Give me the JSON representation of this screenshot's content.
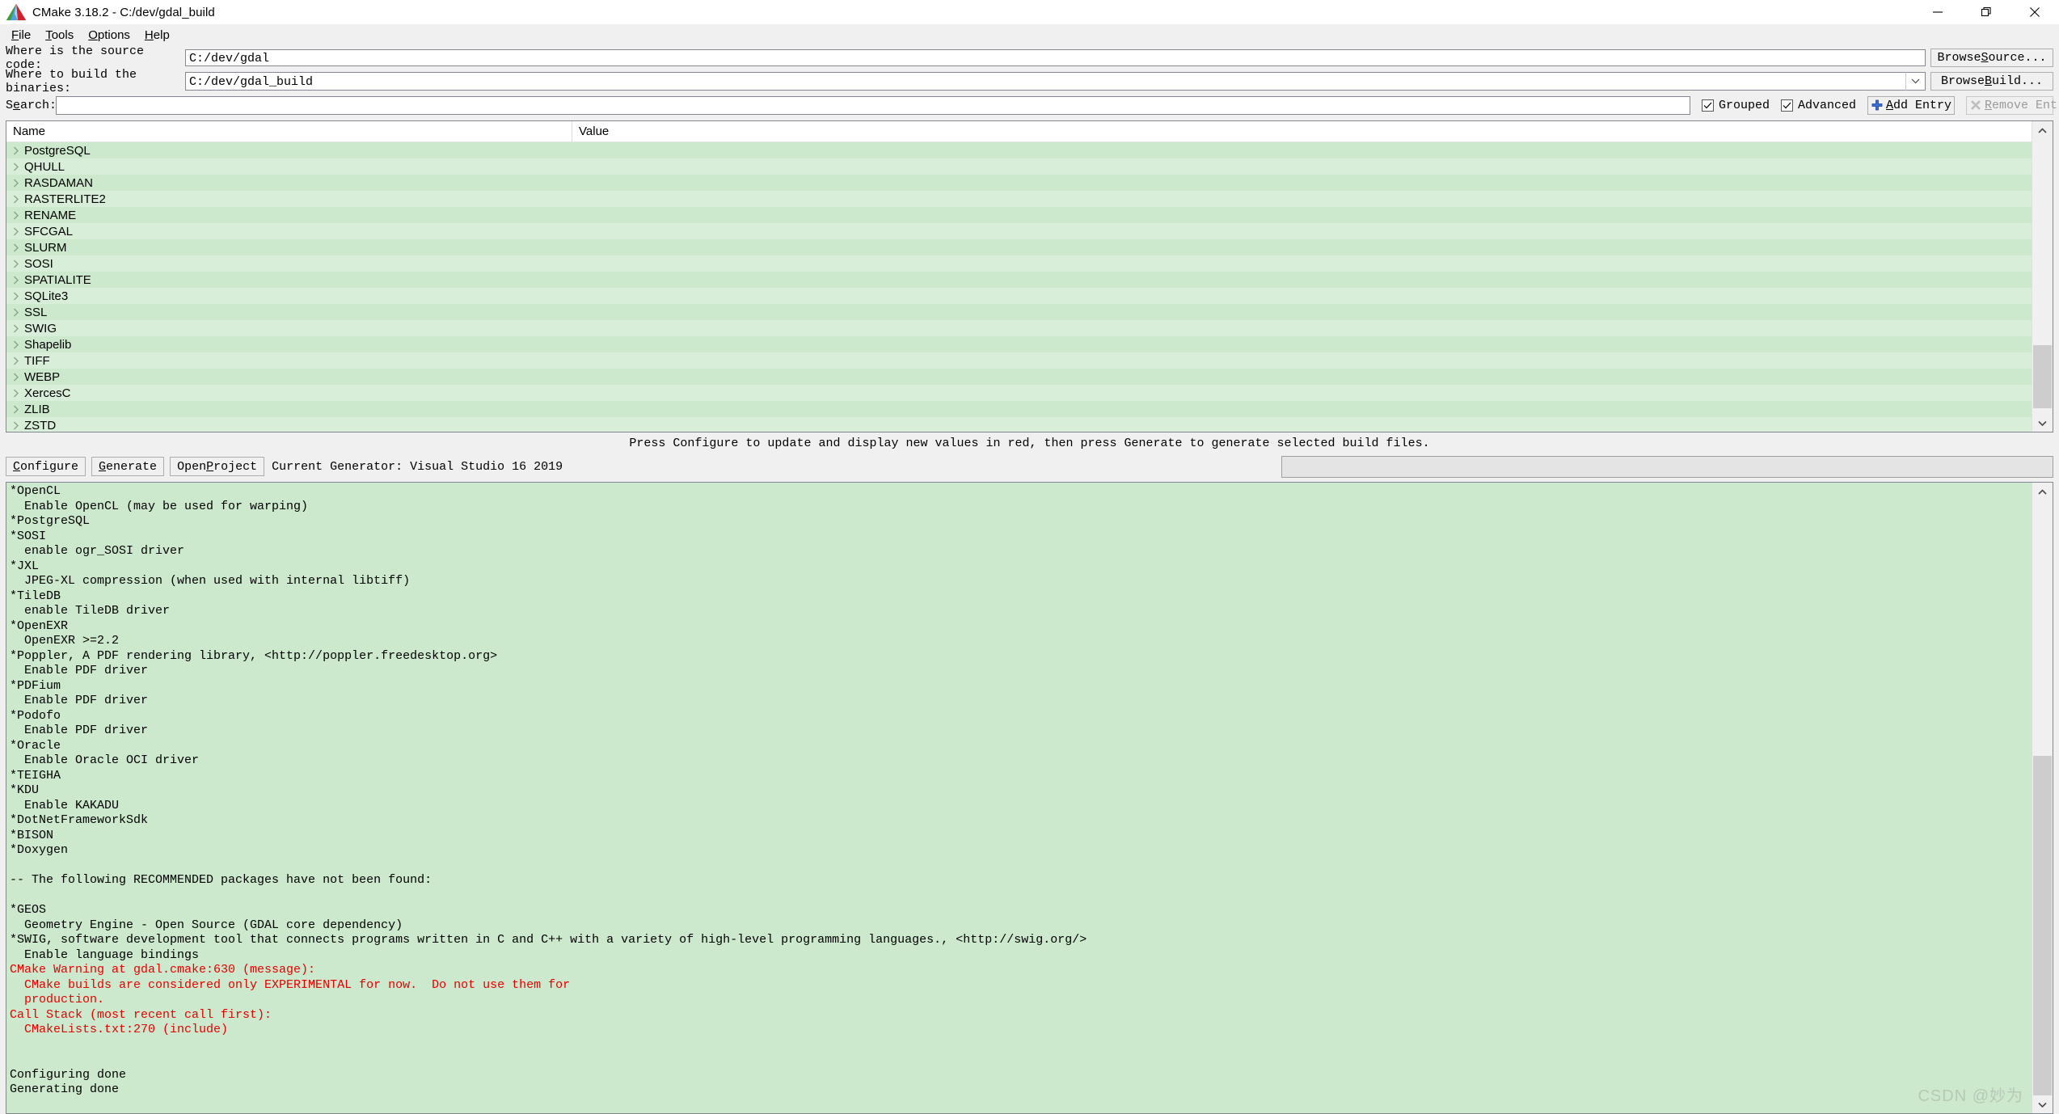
{
  "window": {
    "title": "CMake 3.18.2 - C:/dev/gdal_build",
    "app_icon": "cmake-logo-icon",
    "minimize": "minimize-icon",
    "maximize": "maximize-icon",
    "close": "close-icon"
  },
  "menu": {
    "items": [
      {
        "label": "File",
        "mnemonic": "F"
      },
      {
        "label": "Tools",
        "mnemonic": "T"
      },
      {
        "label": "Options",
        "mnemonic": "O"
      },
      {
        "label": "Help",
        "mnemonic": "H"
      }
    ]
  },
  "source_row": {
    "label": "Where is the source code:",
    "value": "C:/dev/gdal",
    "placeholder": "",
    "button_pre": "Browse ",
    "button_mnemonic": "S",
    "button_post": "ource..."
  },
  "build_row": {
    "label": "Where to build the binaries:",
    "value": "C:/dev/gdal_build",
    "placeholder": "",
    "button_pre": "Browse ",
    "button_mnemonic": "B",
    "button_post": "uild..."
  },
  "search_row": {
    "label_pre": "S",
    "label_mnemonic": "e",
    "label_post": "arch:",
    "value": "",
    "placeholder": "",
    "grouped": {
      "label": "Grouped",
      "checked": true
    },
    "advanced": {
      "label": "Advanced",
      "checked": true
    },
    "add_entry": {
      "pre": "",
      "mnemonic": "A",
      "post": "dd Entry",
      "icon": "plus-icon",
      "enabled": true
    },
    "remove_entry": {
      "pre": "",
      "mnemonic": "R",
      "post": "emove Entry",
      "icon": "remove-icon",
      "enabled": false
    }
  },
  "cache_table": {
    "columns": [
      "Name",
      "Value"
    ],
    "expand_icon": "chevron-right-icon",
    "rows": [
      {
        "name": "PostgreSQL",
        "value": ""
      },
      {
        "name": "QHULL",
        "value": ""
      },
      {
        "name": "RASDAMAN",
        "value": ""
      },
      {
        "name": "RASTERLITE2",
        "value": ""
      },
      {
        "name": "RENAME",
        "value": ""
      },
      {
        "name": "SFCGAL",
        "value": ""
      },
      {
        "name": "SLURM",
        "value": ""
      },
      {
        "name": "SOSI",
        "value": ""
      },
      {
        "name": "SPATIALITE",
        "value": ""
      },
      {
        "name": "SQLite3",
        "value": ""
      },
      {
        "name": "SSL",
        "value": ""
      },
      {
        "name": "SWIG",
        "value": ""
      },
      {
        "name": "Shapelib",
        "value": ""
      },
      {
        "name": "TIFF",
        "value": ""
      },
      {
        "name": "WEBP",
        "value": ""
      },
      {
        "name": "XercesC",
        "value": ""
      },
      {
        "name": "ZLIB",
        "value": ""
      },
      {
        "name": "ZSTD",
        "value": ""
      }
    ],
    "scroll_up_icon": "chevron-up-icon",
    "scroll_down_icon": "chevron-down-icon"
  },
  "status": {
    "message": "Press Configure to update and display new values in red, then press Generate to generate selected build files."
  },
  "actions": {
    "configure": {
      "pre": "",
      "mnemonic": "C",
      "post": "onfigure"
    },
    "generate": {
      "pre": "",
      "mnemonic": "G",
      "post": "enerate"
    },
    "open_project": {
      "pre": "Open ",
      "mnemonic": "P",
      "post": "roject"
    },
    "generator_text": "Current Generator: Visual Studio 16 2019",
    "progress_percent": 0
  },
  "log": {
    "lines_before_warning": "  Enable OpenCL (may be used for warping)\n*PostgreSQL\n*SOSI\n  enable ogr_SOSI driver\n*JXL\n  JPEG-XL compression (when used with internal libtiff)\n*TileDB\n  enable TileDB driver\n*OpenEXR\n  OpenEXR >=2.2\n*Poppler, A PDF rendering library, <http://poppler.freedesktop.org>\n  Enable PDF driver\n*PDFium\n  Enable PDF driver\n*Podofo\n  Enable PDF driver\n*Oracle\n  Enable Oracle OCI driver\n*TEIGHA\n*KDU\n  Enable KAKADU\n*DotNetFrameworkSdk\n*BISON\n*Doxygen\n\n-- The following RECOMMENDED packages have not been found:\n\n*GEOS\n  Geometry Engine - Open Source (GDAL core dependency)\n*SWIG, software development tool that connects programs written in C and C++ with a variety of high-level programming languages., <http://swig.org/>\n  Enable language bindings\n",
    "warning_lines": "CMake Warning at gdal.cmake:630 (message):\n  CMake builds are considered only EXPERIMENTAL for now.  Do not use them for\n  production.\nCall Stack (most recent call first):\n  CMakeLists.txt:270 (include)\n",
    "lines_after_warning": "\n\nConfiguring done\nGenerating done",
    "top_clipped_line": "*OpenCL",
    "scroll_up_icon": "chevron-up-icon",
    "scroll_down_icon": "chevron-down-icon"
  },
  "watermark": {
    "text": "CSDN @妙为"
  },
  "colors": {
    "row_light": "#d8eed8",
    "row_dark": "#cde9cd",
    "log_bg": "#cde9cd",
    "error_text": "#e50000",
    "chrome": "#f0f0f0"
  }
}
